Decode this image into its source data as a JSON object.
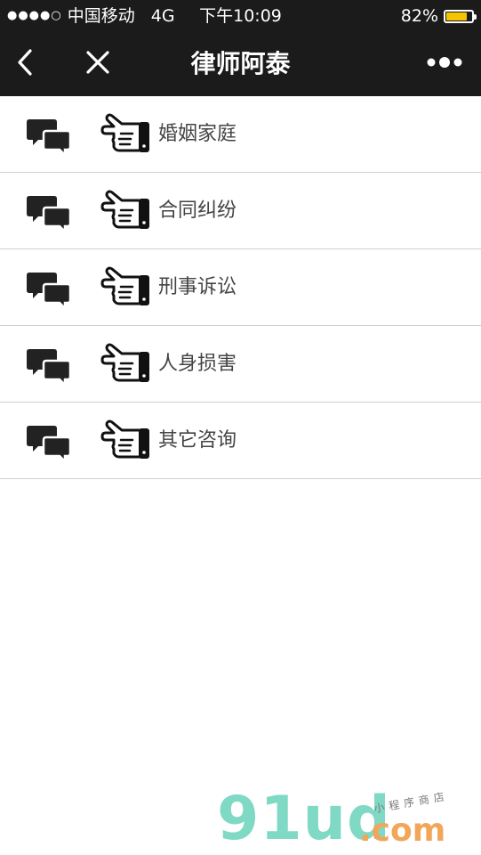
{
  "status_bar": {
    "signal": "●●●●○",
    "carrier": "中国移动",
    "network": "4G",
    "time": "下午10:09",
    "battery_percent": "82%",
    "battery_level": 0.82,
    "battery_color": "#f4c400"
  },
  "nav": {
    "title": "律师阿泰",
    "back_icon": "chevron-left-icon",
    "close_icon": "close-icon",
    "more_icon": "more-dots-icon"
  },
  "menu": {
    "items": [
      {
        "label": "婚姻家庭",
        "icons": [
          "chat-bubbles-icon",
          "pointing-hand-icon"
        ]
      },
      {
        "label": "合同纠纷",
        "icons": [
          "chat-bubbles-icon",
          "pointing-hand-icon"
        ]
      },
      {
        "label": "刑事诉讼",
        "icons": [
          "chat-bubbles-icon",
          "pointing-hand-icon"
        ]
      },
      {
        "label": "人身损害",
        "icons": [
          "chat-bubbles-icon",
          "pointing-hand-icon"
        ]
      },
      {
        "label": "其它咨询",
        "icons": [
          "chat-bubbles-icon",
          "pointing-hand-icon"
        ]
      }
    ]
  },
  "watermark": {
    "logo": "91ud",
    "domain": ".com",
    "tagline": "小程序商店"
  },
  "colors": {
    "header_bg": "#1b1b1b",
    "divider": "#cfcfcf",
    "label_text": "#444444"
  }
}
